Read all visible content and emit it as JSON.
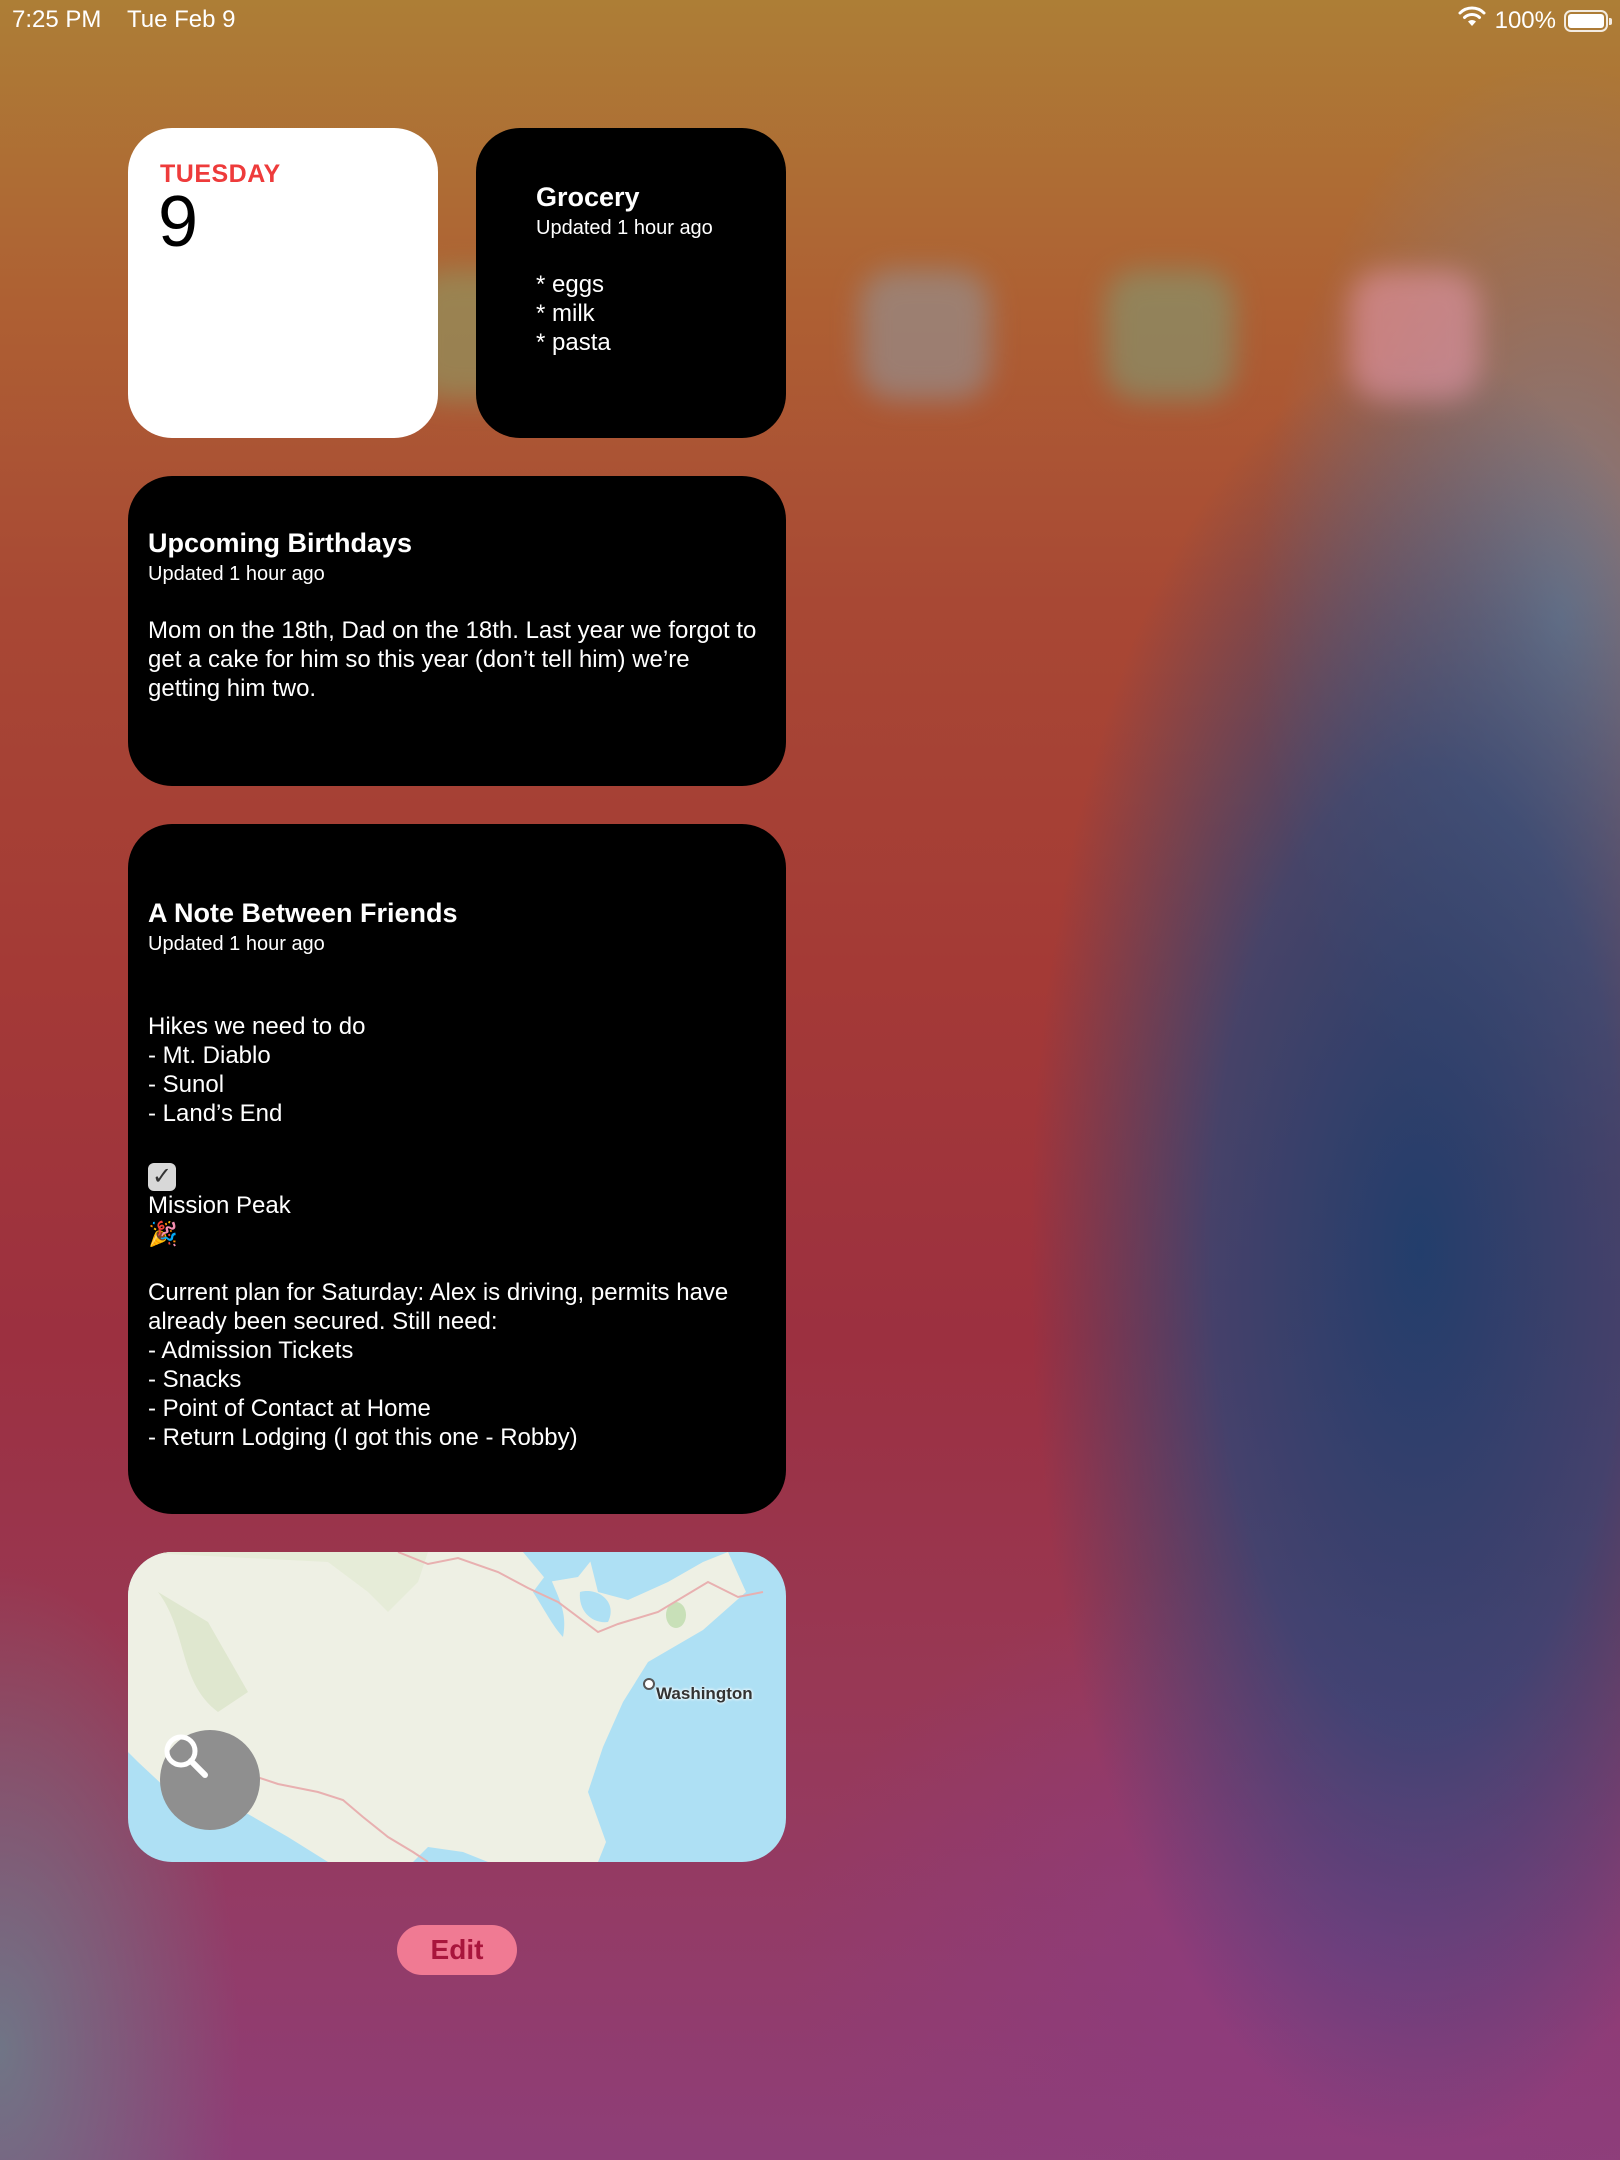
{
  "status_bar": {
    "time": "7:25 PM",
    "date": "Tue Feb 9",
    "battery": "100%"
  },
  "calendar_widget": {
    "weekday": "TUESDAY",
    "day": "9"
  },
  "grocery_widget": {
    "title": "Grocery",
    "updated": "Updated 1 hour ago",
    "body": "* eggs\n* milk\n* pasta"
  },
  "birthdays_widget": {
    "title": "Upcoming Birthdays",
    "updated": "Updated 1 hour ago",
    "body": "Mom on the 18th, Dad on the 18th. Last year we forgot to get a cake for him so this year (don’t tell him) we’re getting him two."
  },
  "note_widget": {
    "title": "A Note Between Friends",
    "updated": "Updated 1 hour ago",
    "body_part1": "Hikes we need to do\n- Mt. Diablo\n- Sunol\n- Land’s End",
    "checked_item": "Mission Peak",
    "party_emoji": "🎉",
    "body_part2": "Current plan for Saturday: Alex is driving, permits have already been secured. Still need:\n- Admission Tickets\n- Snacks\n- Point of Contact at Home\n- Return Lodging (I got this one - Robby)"
  },
  "map_widget": {
    "location_label": "Washington"
  },
  "edit_button": {
    "label": "Edit"
  },
  "colors": {
    "calendar_accent": "#ee3b3b",
    "edit_bg": "#f07a93",
    "edit_text": "#a8153c",
    "map_water": "#aee0f4",
    "map_land": "#eef0e4"
  }
}
